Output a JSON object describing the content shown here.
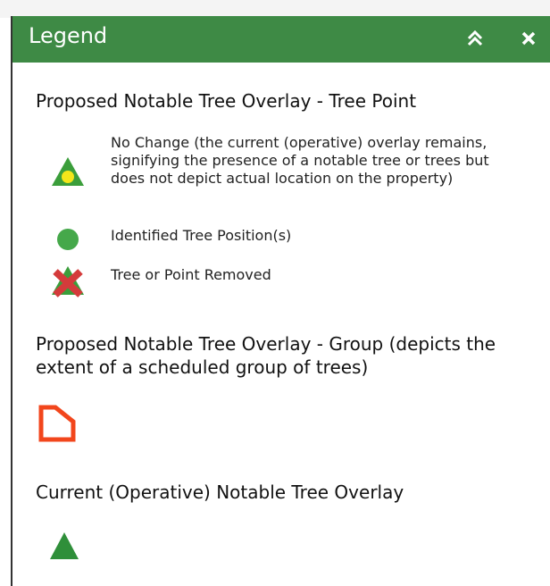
{
  "header": {
    "title": "Legend",
    "collapse_icon": "double-chevron-up-icon",
    "close_icon": "close-icon"
  },
  "colors": {
    "header_bg": "#3e8a45",
    "symbol_green": "#3b9e3b",
    "point_green": "#45a84a",
    "yellow": "#f3e61a",
    "removed_red": "#d43b3b",
    "group_orange": "#f2461c",
    "current_green": "#2f8f3a"
  },
  "sections": [
    {
      "heading": "Proposed Notable Tree Overlay - Tree Point",
      "items": [
        {
          "label": "No Change (the current (operative) overlay remains, signifying the presence of a notable tree or trees but does not depict actual location on the property)",
          "icon": "green-triangle-yellow-dot-icon"
        },
        {
          "label": "Identified Tree Position(s)",
          "icon": "green-circle-icon"
        },
        {
          "label": "Tree or Point Removed",
          "icon": "red-x-green-triangle-icon"
        }
      ]
    },
    {
      "heading": "Proposed Notable Tree Overlay - Group (depicts the extent of a scheduled group of trees)",
      "icon": "orange-polygon-icon"
    },
    {
      "heading": "Current (Operative) Notable Tree Overlay",
      "icon": "green-triangle-icon"
    }
  ]
}
